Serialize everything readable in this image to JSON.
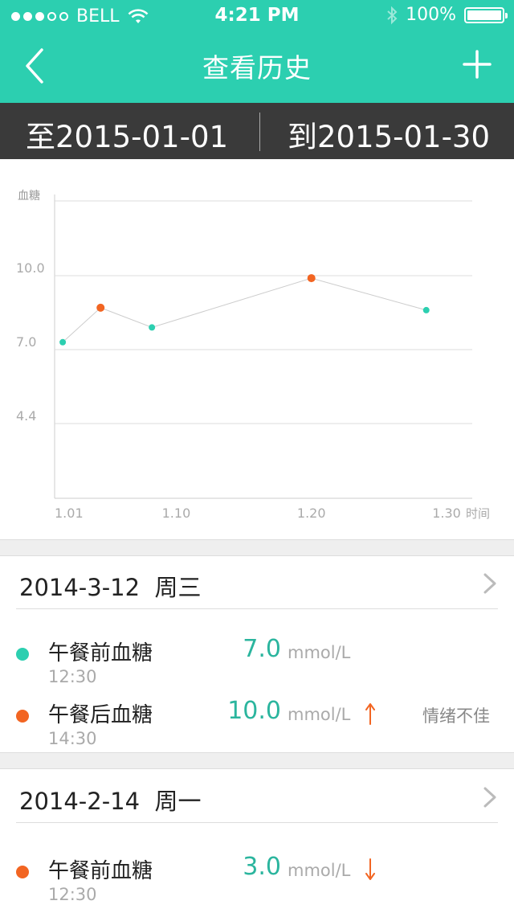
{
  "status": {
    "carrier": "BELL",
    "time": "4:21 PM",
    "battery": "100%",
    "signal_bars_filled": 3,
    "signal_bars_total": 5
  },
  "nav": {
    "title": "查看历史"
  },
  "date_range": {
    "from": "至2015-01-01",
    "to": "到2015-01-30"
  },
  "colors": {
    "accent": "#2ccfb0",
    "value_text": "#2bb59e",
    "orange": "#f26522",
    "dark_bar": "#3a3a3a"
  },
  "chart_data": {
    "type": "scatter",
    "ylabel": "血糖",
    "xlabel": "时间",
    "y_ticks": [
      "10.0",
      "7.0",
      "4.4"
    ],
    "x_ticks": [
      "1.01",
      "1.10",
      "1.20",
      "1.30"
    ],
    "x_tick_values": [
      1.01,
      1.1,
      1.2,
      1.3
    ],
    "y_tick_values": [
      10.0,
      7.0,
      4.4
    ],
    "points": [
      {
        "x": 1.016,
        "y": 7.3,
        "status": "normal"
      },
      {
        "x": 1.044,
        "y": 8.7,
        "status": "high"
      },
      {
        "x": 1.082,
        "y": 7.9,
        "status": "normal"
      },
      {
        "x": 1.2,
        "y": 9.9,
        "status": "high"
      },
      {
        "x": 1.285,
        "y": 8.6,
        "status": "normal"
      }
    ]
  },
  "days": [
    {
      "date": "2014-3-12",
      "weekday": "周三",
      "records": [
        {
          "name": "午餐前血糖",
          "time": "12:30",
          "value": "7.0",
          "unit": "mmol/L",
          "status": "normal",
          "arrow": "",
          "note": ""
        },
        {
          "name": "午餐后血糖",
          "time": "14:30",
          "value": "10.0",
          "unit": "mmol/L",
          "status": "high",
          "arrow": "up",
          "note": "情绪不佳"
        }
      ]
    },
    {
      "date": "2014-2-14",
      "weekday": "周一",
      "records": [
        {
          "name": "午餐前血糖",
          "time": "12:30",
          "value": "3.0",
          "unit": "mmol/L",
          "status": "high",
          "arrow": "down",
          "note": ""
        }
      ]
    }
  ]
}
